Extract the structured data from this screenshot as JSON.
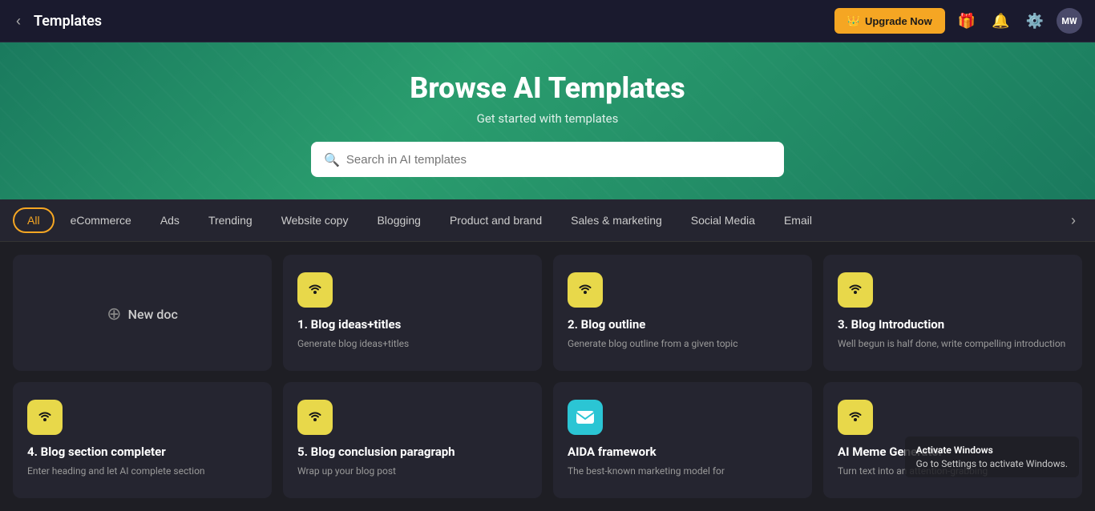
{
  "header": {
    "title": "Templates",
    "upgrade_label": "Upgrade Now",
    "avatar_initials": "MW"
  },
  "hero": {
    "title": "Browse AI Templates",
    "subtitle": "Get started with templates",
    "search_placeholder": "Search in AI templates"
  },
  "tabs": [
    {
      "id": "all",
      "label": "All",
      "active": true
    },
    {
      "id": "ecommerce",
      "label": "eCommerce",
      "active": false
    },
    {
      "id": "ads",
      "label": "Ads",
      "active": false
    },
    {
      "id": "trending",
      "label": "Trending",
      "active": false
    },
    {
      "id": "website-copy",
      "label": "Website copy",
      "active": false
    },
    {
      "id": "blogging",
      "label": "Blogging",
      "active": false
    },
    {
      "id": "product-brand",
      "label": "Product and brand",
      "active": false
    },
    {
      "id": "sales-marketing",
      "label": "Sales & marketing",
      "active": false
    },
    {
      "id": "social-media",
      "label": "Social Media",
      "active": false
    },
    {
      "id": "email",
      "label": "Email",
      "active": false
    }
  ],
  "new_doc_label": "New doc",
  "templates": [
    {
      "id": "blog-ideas",
      "title": "1. Blog ideas+titles",
      "description": "Generate blog ideas+titles",
      "icon_type": "b",
      "icon_color": "yellow"
    },
    {
      "id": "blog-outline",
      "title": "2. Blog outline",
      "description": "Generate blog outline from a given topic",
      "icon_type": "b",
      "icon_color": "yellow"
    },
    {
      "id": "blog-intro",
      "title": "3. Blog Introduction",
      "description": "Well begun is half done, write compelling introduction",
      "icon_type": "b",
      "icon_color": "yellow"
    },
    {
      "id": "blog-section",
      "title": "4. Blog section completer",
      "description": "Enter heading and let AI complete section",
      "icon_type": "b",
      "icon_color": "yellow"
    },
    {
      "id": "blog-conclusion",
      "title": "5. Blog conclusion paragraph",
      "description": "Wrap up your blog post",
      "icon_type": "b",
      "icon_color": "yellow"
    },
    {
      "id": "aida",
      "title": "AIDA framework",
      "description": "The best-known marketing model for",
      "icon_type": "email",
      "icon_color": "cyan"
    },
    {
      "id": "ai-meme",
      "title": "AI Meme Generator",
      "description": "Turn text into an attention-grabbing",
      "icon_type": "b",
      "icon_color": "yellow"
    }
  ],
  "activate_windows": "Activate Windows",
  "activate_sub": "Go to Settings to activate Windows."
}
